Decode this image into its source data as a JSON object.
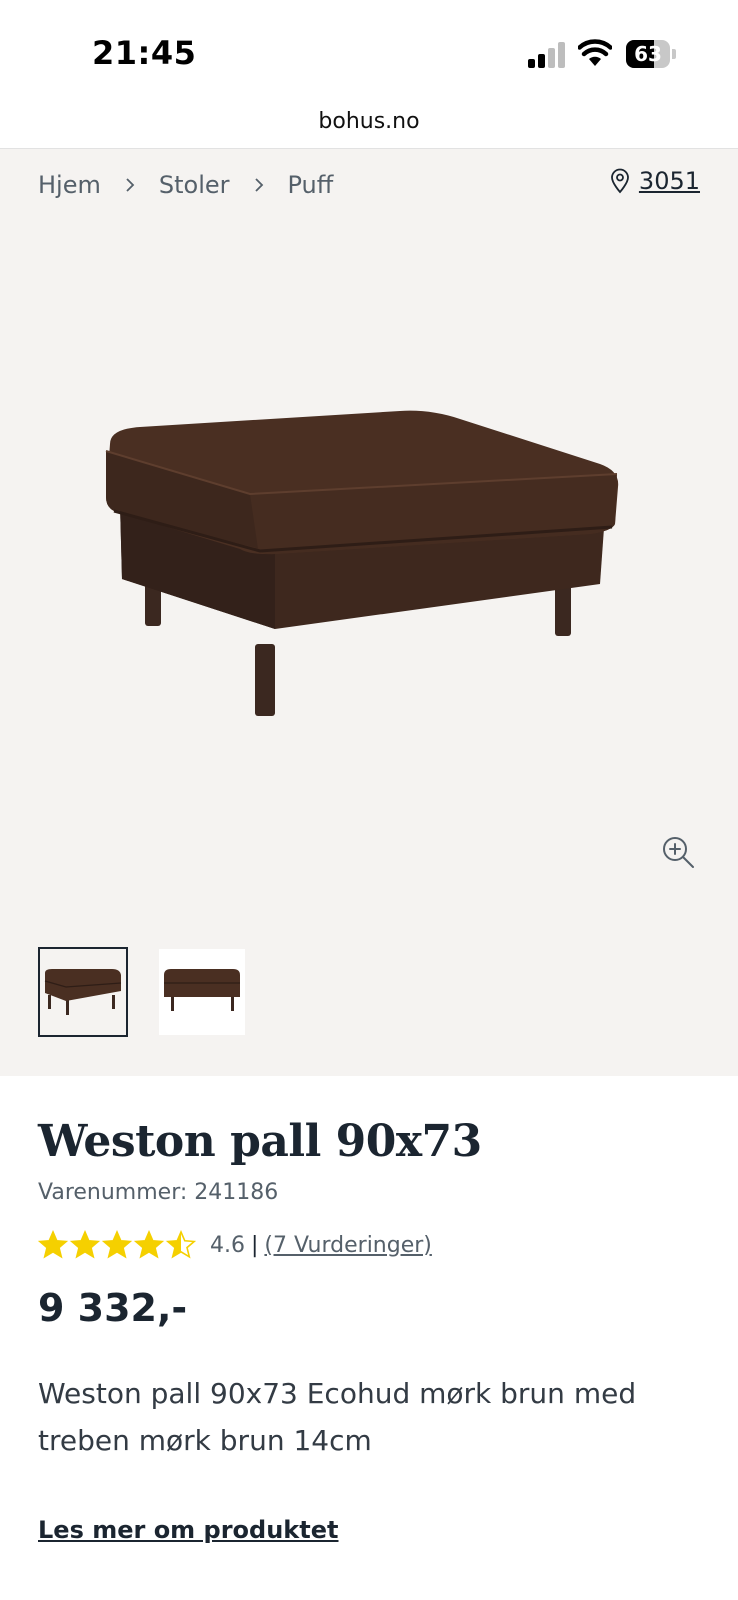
{
  "status_bar": {
    "time": "21:45",
    "battery_level": "63",
    "battery_fraction": 0.63
  },
  "browser": {
    "url": "bohus.no"
  },
  "breadcrumb": {
    "items": [
      "Hjem",
      "Stoler",
      "Puff"
    ]
  },
  "store": {
    "code": "3051"
  },
  "product": {
    "title": "Weston pall 90x73",
    "sku": "Varenummer: 241186",
    "rating_value": "4.6",
    "rating_stars": 4.6,
    "rating_separator": "|",
    "rating_count": "(7 Vurderinger)",
    "price": "9 332,-",
    "description": "Weston pall 90x73 Ecohud mørk brun med treben mørk brun 14cm",
    "read_more": "Les mer om produktet"
  },
  "colors": {
    "leather": "#4a2f22",
    "star": "#f5d000",
    "ink": "#1b2530",
    "gallery_bg": "#f5f3f1"
  }
}
